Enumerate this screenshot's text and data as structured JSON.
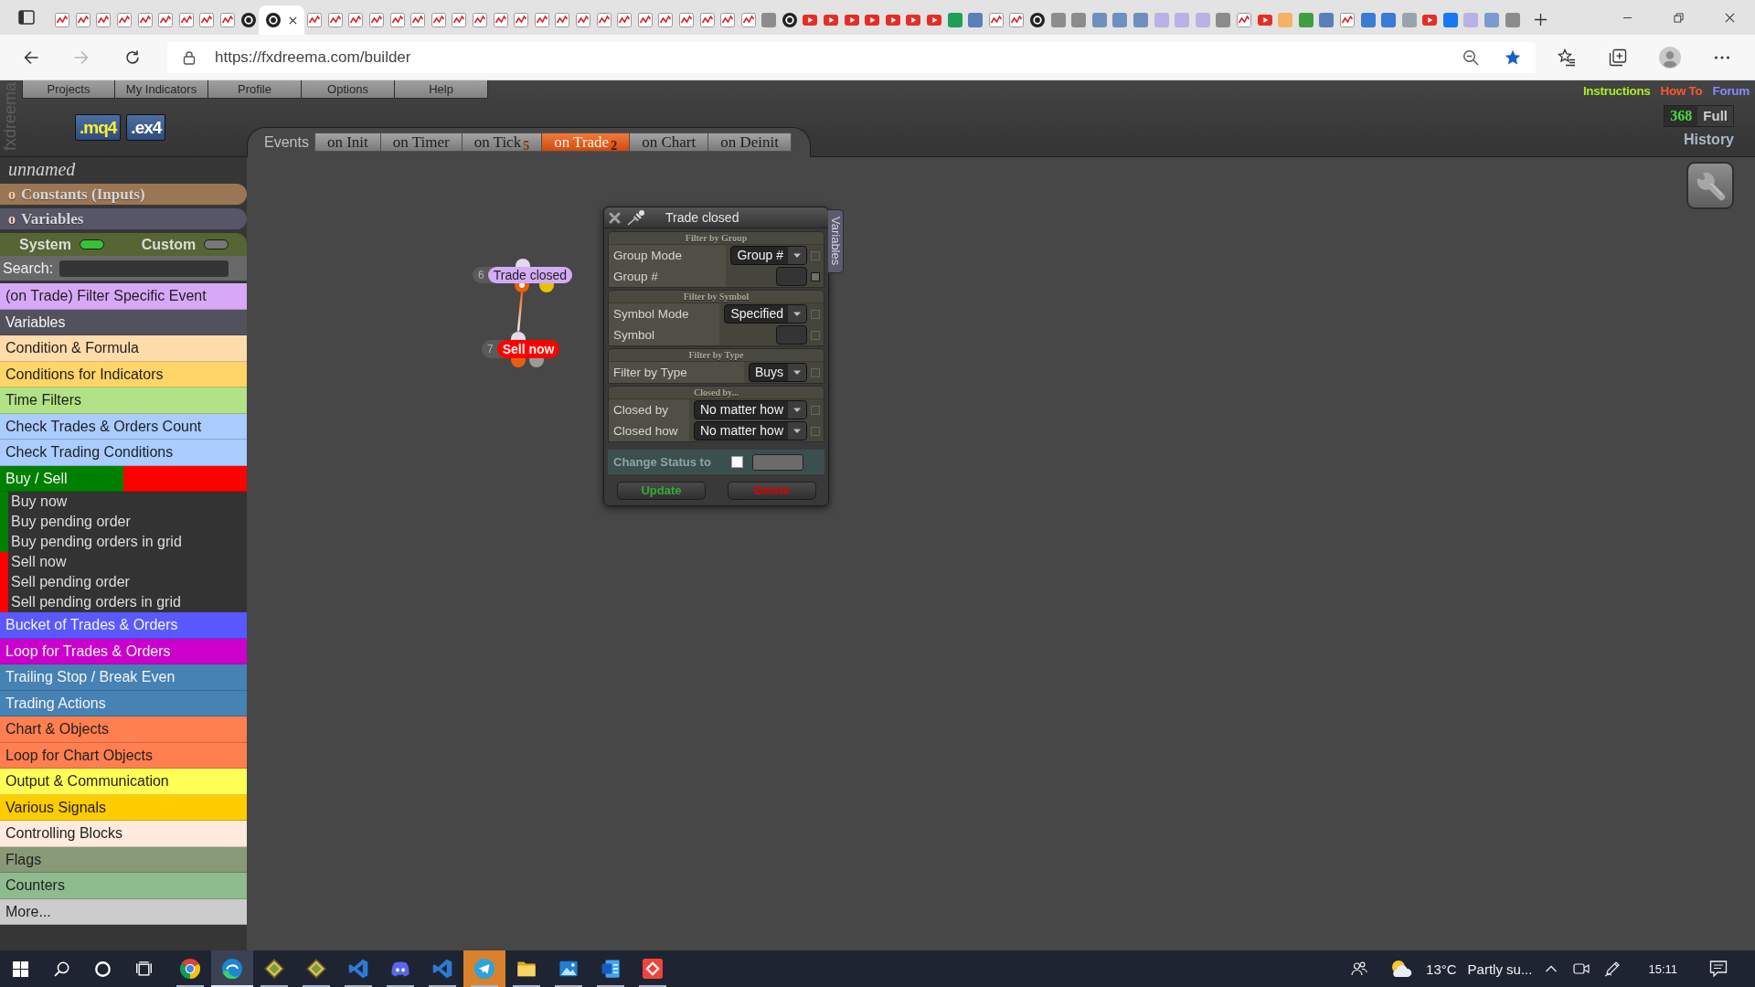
{
  "browser": {
    "tabs": [
      {
        "kind": "chart",
        "selected": false
      },
      {
        "kind": "chart",
        "selected": false
      },
      {
        "kind": "chart",
        "selected": false
      },
      {
        "kind": "chart",
        "selected": false
      },
      {
        "kind": "chart",
        "selected": false
      },
      {
        "kind": "chart",
        "selected": false
      },
      {
        "kind": "chart",
        "selected": false
      },
      {
        "kind": "chart",
        "selected": false
      },
      {
        "kind": "chart",
        "selected": false
      },
      {
        "kind": "disc",
        "selected": false
      },
      {
        "kind": "disc",
        "selected": true
      },
      {
        "kind": "chart",
        "selected": false
      },
      {
        "kind": "chart",
        "selected": false
      },
      {
        "kind": "chart",
        "selected": false
      },
      {
        "kind": "chart",
        "selected": false
      },
      {
        "kind": "chart",
        "selected": false
      },
      {
        "kind": "chart",
        "selected": false
      },
      {
        "kind": "chart",
        "selected": false
      },
      {
        "kind": "chart",
        "selected": false
      },
      {
        "kind": "chart",
        "selected": false
      },
      {
        "kind": "chart",
        "selected": false
      },
      {
        "kind": "chart",
        "selected": false
      },
      {
        "kind": "chart",
        "selected": false
      },
      {
        "kind": "chart",
        "selected": false
      },
      {
        "kind": "chart",
        "selected": false
      },
      {
        "kind": "chart",
        "selected": false
      },
      {
        "kind": "chart",
        "selected": false
      },
      {
        "kind": "chart",
        "selected": false
      },
      {
        "kind": "chart",
        "selected": false
      },
      {
        "kind": "chart",
        "selected": false
      },
      {
        "kind": "chart",
        "selected": false
      },
      {
        "kind": "chart",
        "selected": false
      },
      {
        "kind": "chart",
        "selected": false
      },
      {
        "kind": "tile",
        "color": "#8c8c8c",
        "selected": false
      },
      {
        "kind": "disc",
        "selected": false
      },
      {
        "kind": "video",
        "selected": false
      },
      {
        "kind": "video",
        "selected": false
      },
      {
        "kind": "video",
        "selected": false
      },
      {
        "kind": "video",
        "selected": false
      },
      {
        "kind": "video",
        "selected": false
      },
      {
        "kind": "video",
        "selected": false
      },
      {
        "kind": "video",
        "selected": false
      },
      {
        "kind": "tile",
        "color": "#1e9e5a",
        "selected": false
      },
      {
        "kind": "tile",
        "color": "#5a7fb8",
        "selected": false
      },
      {
        "kind": "chart",
        "selected": false
      },
      {
        "kind": "chart",
        "selected": false
      },
      {
        "kind": "disc",
        "selected": false
      },
      {
        "kind": "tile",
        "color": "#8c8c8c",
        "selected": false
      },
      {
        "kind": "tile",
        "color": "#8c8c8c",
        "selected": false
      },
      {
        "kind": "tile",
        "color": "#6f8fbf",
        "selected": false
      },
      {
        "kind": "tile",
        "color": "#6f8fbf",
        "selected": false
      },
      {
        "kind": "tile",
        "color": "#6f8fbf",
        "selected": false
      },
      {
        "kind": "tile",
        "color": "#b9b2e6",
        "selected": false
      },
      {
        "kind": "tile",
        "color": "#b9b2e6",
        "selected": false
      },
      {
        "kind": "tile",
        "color": "#b9b2e6",
        "selected": false
      },
      {
        "kind": "tile",
        "color": "#8c8c8c",
        "selected": false
      },
      {
        "kind": "chart",
        "selected": false
      },
      {
        "kind": "video",
        "selected": false
      },
      {
        "kind": "tile",
        "color": "#f2b366",
        "selected": false
      },
      {
        "kind": "tile",
        "color": "#3f9f3f",
        "selected": false
      },
      {
        "kind": "tile",
        "color": "#5a7fb8",
        "selected": false
      },
      {
        "kind": "chart",
        "selected": false
      },
      {
        "kind": "tile",
        "color": "#3a7bd5",
        "selected": false
      },
      {
        "kind": "tile",
        "color": "#3a7bd5",
        "selected": false
      },
      {
        "kind": "tile",
        "color": "#9aa3ad",
        "selected": false
      },
      {
        "kind": "video",
        "selected": false
      },
      {
        "kind": "tile",
        "color": "#1877f2",
        "selected": false
      },
      {
        "kind": "tile",
        "color": "#b9b2e6",
        "selected": false
      },
      {
        "kind": "tile",
        "color": "#7a9ad0",
        "selected": false
      },
      {
        "kind": "tile",
        "color": "#8c8c8c",
        "selected": false
      }
    ],
    "address": "https://fxdreema.com/builder"
  },
  "app": {
    "logo": "fxdreema",
    "menu": [
      "Projects",
      "My Indicators",
      "Profile",
      "Options",
      "Help"
    ],
    "links": [
      {
        "label": "Instructions",
        "color": "#aaee22"
      },
      {
        "label": "How To",
        "color": "#ff5533"
      },
      {
        "label": "Forum",
        "color": "#8888ff"
      }
    ],
    "file_buttons": [
      {
        "label": ".mq4",
        "color": "#ffee33"
      },
      {
        "label": ".ex4",
        "color": "#ffffff"
      }
    ],
    "counter": {
      "value": "368",
      "label": "Full"
    },
    "history": "History",
    "events": {
      "label": "Events",
      "tabs": [
        {
          "label": "on Init",
          "selected": false
        },
        {
          "label": "on Timer",
          "selected": false
        },
        {
          "label": "on Tick",
          "count": "5",
          "selected": false
        },
        {
          "label": "on Trade",
          "count": "2",
          "selected": true
        },
        {
          "label": "on Chart",
          "selected": false
        },
        {
          "label": "on Deinit",
          "selected": false
        }
      ]
    },
    "sidebar": {
      "project_name": "unnamed",
      "sections": [
        {
          "marker": "o",
          "label": "Constants (Inputs)",
          "color": "#9b7656"
        },
        {
          "marker": "o",
          "label": "Variables",
          "color": "#565668"
        }
      ],
      "toggles": [
        {
          "label": "System",
          "on": true
        },
        {
          "label": "Custom",
          "on": false
        }
      ],
      "search": {
        "label": "Search:"
      },
      "categories": [
        {
          "kind": "category",
          "label": "(on Trade) Filter Specific Event",
          "color": "#d8a8f8"
        },
        {
          "kind": "category",
          "label": "Variables",
          "color": "#52525f"
        },
        {
          "kind": "category",
          "label": "Condition & Formula",
          "color": "#ffdcaa"
        },
        {
          "kind": "category",
          "label": "Conditions for Indicators",
          "color": "#ffd567"
        },
        {
          "kind": "category",
          "label": "Time Filters",
          "color": "#b2e286"
        },
        {
          "kind": "category",
          "label": "Check Trades & Orders Count",
          "color": "#aaccff"
        },
        {
          "kind": "category",
          "label": "Check Trading Conditions",
          "color": "#aaccff"
        },
        {
          "kind": "group",
          "label": "Buy / Sell",
          "children": [
            {
              "label": "Buy now",
              "color": "#008000"
            },
            {
              "label": "Buy pending order",
              "color": "#008000"
            },
            {
              "label": "Buy pending orders in grid",
              "color": "#008000"
            },
            {
              "label": "Sell now",
              "color": "#ff0000"
            },
            {
              "label": "Sell pending order",
              "color": "#ff0000"
            },
            {
              "label": "Sell pending orders in grid",
              "color": "#ff0000"
            }
          ]
        },
        {
          "kind": "category",
          "label": "Bucket of Trades & Orders",
          "color": "#5959ff"
        },
        {
          "kind": "category",
          "label": "Loop for Trades & Orders",
          "color": "#cc00cc"
        },
        {
          "kind": "category",
          "label": "Trailing Stop / Break Even",
          "color": "#4682b4"
        },
        {
          "kind": "category",
          "label": "Trading Actions",
          "color": "#4682b4"
        },
        {
          "kind": "category",
          "label": "Chart & Objects",
          "color": "#ff7f50"
        },
        {
          "kind": "category",
          "label": "Loop for Chart Objects",
          "color": "#ff7f50"
        },
        {
          "kind": "category",
          "label": "Output & Communication",
          "color": "#ffff55"
        },
        {
          "kind": "category",
          "label": "Various Signals",
          "color": "#ffcc00"
        },
        {
          "kind": "category",
          "label": "Controlling Blocks",
          "color": "#ffebdd"
        },
        {
          "kind": "category",
          "label": "Flags",
          "color": "#889977"
        },
        {
          "kind": "category",
          "label": "Counters",
          "color": "#8fbc8f"
        },
        {
          "kind": "category",
          "label": "More...",
          "color": "#cccccc"
        }
      ]
    },
    "canvas": {
      "nodes": [
        {
          "number": "6",
          "label": "Trade closed",
          "kind": "event",
          "color": "#d4acf6",
          "outputs": [
            {
              "color": "#e8600e",
              "connected": true
            },
            {
              "color": "#e6c200",
              "connected": false
            }
          ]
        },
        {
          "number": "7",
          "label": "Sell now",
          "kind": "action",
          "color": "#ff0000",
          "outputs": [
            {
              "color": "#e8600e",
              "connected": false
            },
            {
              "color": "#9a9a9a",
              "connected": false
            }
          ]
        }
      ],
      "dialog": {
        "title": "Trade closed",
        "side_tab": "Variables",
        "sections": [
          {
            "title": "Filter by Group",
            "rows": [
              {
                "label": "Group Mode",
                "kind": "select",
                "value": "Group #",
                "checkbox": {
                  "checked": false,
                  "disabled": true
                }
              },
              {
                "label": "Group #",
                "kind": "input",
                "checkbox": {
                  "checked": false,
                  "disabled": false
                }
              }
            ]
          },
          {
            "title": "Filter by Symbol",
            "rows": [
              {
                "label": "Symbol Mode",
                "kind": "select",
                "value": "Specified",
                "checkbox": {
                  "checked": false,
                  "disabled": true
                }
              },
              {
                "label": "Symbol",
                "kind": "input",
                "checkbox": {
                  "checked": false,
                  "disabled": true
                }
              }
            ]
          },
          {
            "title": "Filter by Type",
            "rows": [
              {
                "label": "Filter by Type",
                "kind": "select",
                "value": "Buys",
                "checkbox": {
                  "checked": false,
                  "disabled": true
                }
              }
            ]
          },
          {
            "title": "Closed by...",
            "rows": [
              {
                "label": "Closed by",
                "kind": "select",
                "value": "No matter how",
                "checkbox": {
                  "checked": false,
                  "disabled": true
                }
              },
              {
                "label": "Closed how",
                "kind": "select",
                "value": "No matter how",
                "checkbox": {
                  "checked": false,
                  "disabled": true
                }
              }
            ]
          }
        ],
        "status": {
          "label": "Change Status to",
          "checked": false
        },
        "buttons": [
          {
            "label": "Update",
            "color": "#33aa33"
          },
          {
            "label": "Delete",
            "color": "#dd0000"
          }
        ]
      }
    }
  },
  "taskbar": {
    "apps": [
      {
        "kind": "chrome",
        "running": true,
        "selected": false,
        "attention": false
      },
      {
        "kind": "edge",
        "running": true,
        "selected": true,
        "attention": false
      },
      {
        "kind": "diamond",
        "running": true,
        "selected": false,
        "attention": false
      },
      {
        "kind": "diamond",
        "running": true,
        "selected": false,
        "attention": false
      },
      {
        "kind": "code",
        "running": true,
        "selected": false,
        "attention": false
      },
      {
        "kind": "discord",
        "running": true,
        "selected": false,
        "attention": false
      },
      {
        "kind": "code",
        "running": true,
        "selected": false,
        "attention": false
      },
      {
        "kind": "telegram",
        "running": true,
        "selected": false,
        "attention": true
      },
      {
        "kind": "folder",
        "running": true,
        "selected": false,
        "attention": false
      },
      {
        "kind": "photos",
        "running": true,
        "selected": false,
        "attention": false
      },
      {
        "kind": "word",
        "running": true,
        "selected": false,
        "attention": false
      },
      {
        "kind": "remote",
        "running": true,
        "selected": false,
        "attention": false
      }
    ],
    "weather": {
      "temperature": "13°C",
      "summary": "Partly su..."
    },
    "time": "15:11"
  }
}
